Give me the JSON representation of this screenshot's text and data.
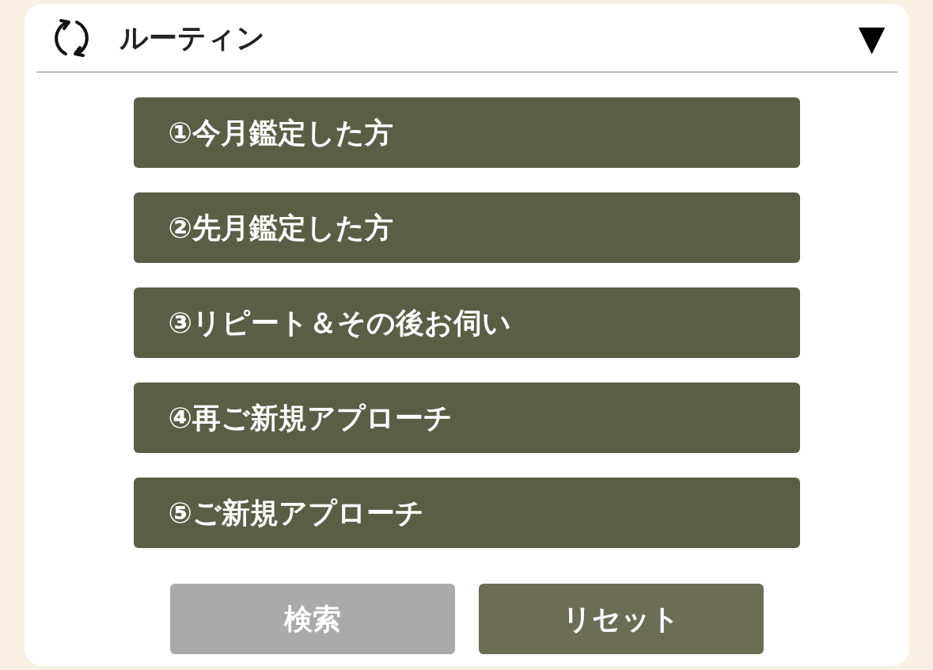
{
  "panel": {
    "title": "ルーティン",
    "toggle": "▼",
    "expanded": true
  },
  "routines": [
    {
      "label": "①今月鑑定した方"
    },
    {
      "label": "②先月鑑定した方"
    },
    {
      "label": "③リピート＆その後お伺い"
    },
    {
      "label": "④再ご新規アプローチ"
    },
    {
      "label": "⑤ご新規アプローチ"
    }
  ],
  "actions": [
    {
      "label": "検索",
      "disabled": true
    },
    {
      "label": "リセット",
      "disabled": false
    }
  ]
}
